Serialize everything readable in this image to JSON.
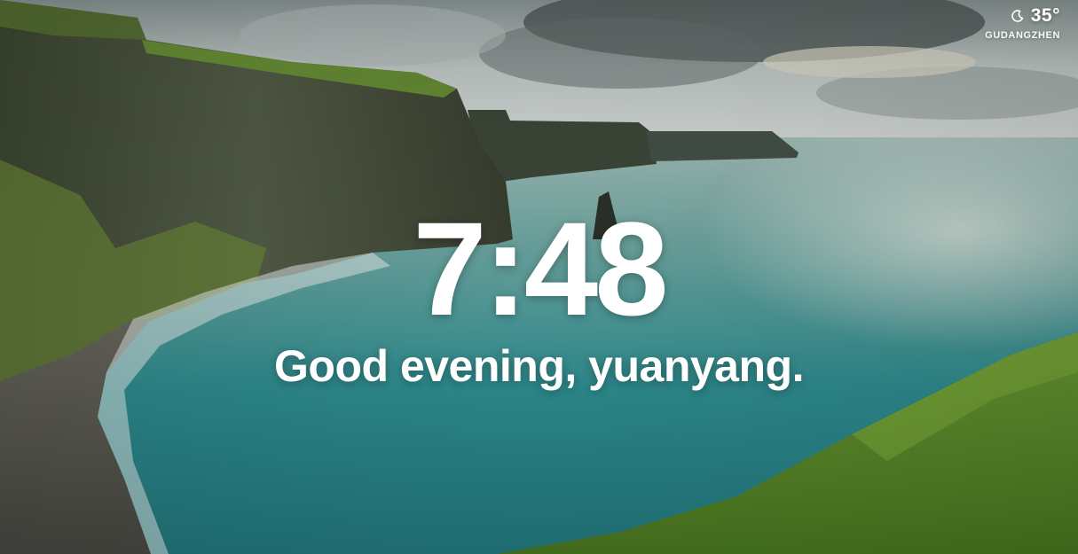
{
  "weather": {
    "icon": "moon-icon",
    "temperature": "35°",
    "location": "GUDANGZHEN"
  },
  "clock": {
    "time": "7:48"
  },
  "greeting": {
    "text": "Good evening, yuanyang."
  },
  "colors": {
    "text": "#ffffff",
    "sea": "#3f9a9a",
    "cliff": "#4a5a3a",
    "grass": "#5f8f2e",
    "sky": "#c9d3d2"
  }
}
